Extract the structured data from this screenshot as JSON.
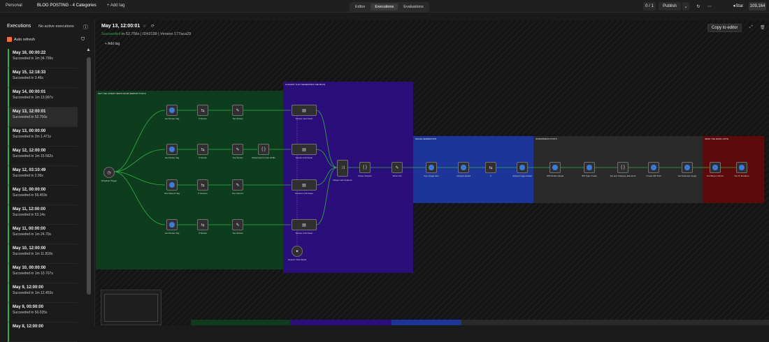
{
  "topbar": {
    "personal": "Personal",
    "workflow_name": "BLOG POSTING - 4 Categories",
    "add_tag": "+ Add tag",
    "tabs": [
      {
        "label": "Editor",
        "active": false
      },
      {
        "label": "Executions",
        "active": true
      },
      {
        "label": "Evaluations",
        "active": false
      }
    ],
    "counter": "0 / 1",
    "publish_label": "Publish",
    "star_label": "Star",
    "star_count": "109,164"
  },
  "sidebar": {
    "title": "Executions",
    "active_status": "No active executions",
    "auto_refresh_label": "Auto refresh",
    "items": [
      {
        "date": "May 16, 00:00:22",
        "status": "Succeeded in 1m 34.799s"
      },
      {
        "date": "May 15, 12:18:33",
        "status": "Succeeded in 3.46s"
      },
      {
        "date": "May 14, 00:00:01",
        "status": "Succeeded in 1m 13.997s"
      },
      {
        "date": "May 13, 12:00:01",
        "status": "Succeeded in 52.756s"
      },
      {
        "date": "May 13, 00:00:00",
        "status": "Succeeded in 2m 1.471s"
      },
      {
        "date": "May 12, 12:00:00",
        "status": "Succeeded in 1m 15.562s"
      },
      {
        "date": "May 12, 03:10:49",
        "status": "Succeeded in 2.96s"
      },
      {
        "date": "May 12, 00:00:00",
        "status": "Succeeded in 59.459s"
      },
      {
        "date": "May 11, 12:00:00",
        "status": "Succeeded in 53.14s"
      },
      {
        "date": "May 11, 00:00:00",
        "status": "Succeeded in 1m 24.70s"
      },
      {
        "date": "May 10, 12:00:00",
        "status": "Succeeded in 1m 11.818s"
      },
      {
        "date": "May 10, 00:00:00",
        "status": "Succeeded in 1m 10.707s"
      },
      {
        "date": "May 9, 12:00:00",
        "status": "Succeeded in 1m 12.453s"
      },
      {
        "date": "May 9, 00:00:00",
        "status": "Succeeded in 50.035s"
      },
      {
        "date": "May 8, 12:00:00",
        "status": ""
      }
    ]
  },
  "execution": {
    "title": "May 13, 12:00:01",
    "status_word": "Succeeded",
    "status_rest": "in 52.756s | ID#2199 | Version 177aca29",
    "add_tag": "+ Add tag",
    "copy_button": "Copy to editor"
  },
  "regions": [
    {
      "label": "GET THE LATEST NEWS FROM SERPAPI TOOLS",
      "color": "#0e3d1d"
    },
    {
      "label": "AI AGENT THAT GENERATES THE BLOG",
      "color": "#2a0f7a"
    },
    {
      "label": "IMAGE GENERATION",
      "color": "#1d3599"
    },
    {
      "label": "WORDPRESS POSTS",
      "color": "#2a2a2a"
    },
    {
      "label": "SEND THE EMAIL NOTE",
      "color": "#5c0a0a"
    }
  ],
  "nodes": {
    "schedule": "Schedule Trigger",
    "search": [
      "Get Stories Tag",
      "Get Stocks Tag",
      "Get Gamers Tag",
      "Get Stories Tag"
    ],
    "filter": [
      "If Stories",
      "If Stocks",
      "If Gamers",
      "If Stories"
    ],
    "format": [
      "Top Stories",
      "Top Stocks",
      "Top Gamers",
      "Top Stories"
    ],
    "extra": "Wordpress Format HTML",
    "agents": [
      "Stories Last Clean",
      "Stocks LLM Clean",
      "Gamers LLM Clean",
      "Stories LLM Clean"
    ],
    "merge": "Merge Last Subjects",
    "openai": "OpenAI Chat Model",
    "pipeline": [
      "Parse Outputs",
      "Write Info",
      "Gen Image Item",
      "Upload Upload",
      "If",
      "Upload Image Delete"
    ],
    "wordpress": [
      "WP Media Upload",
      "WP Tags Create",
      "Set and Category Elements",
      "Create WP Post",
      "Get Selected Image"
    ],
    "email": [
      "Get Blog in Admin",
      "Set To Emailers"
    ]
  }
}
